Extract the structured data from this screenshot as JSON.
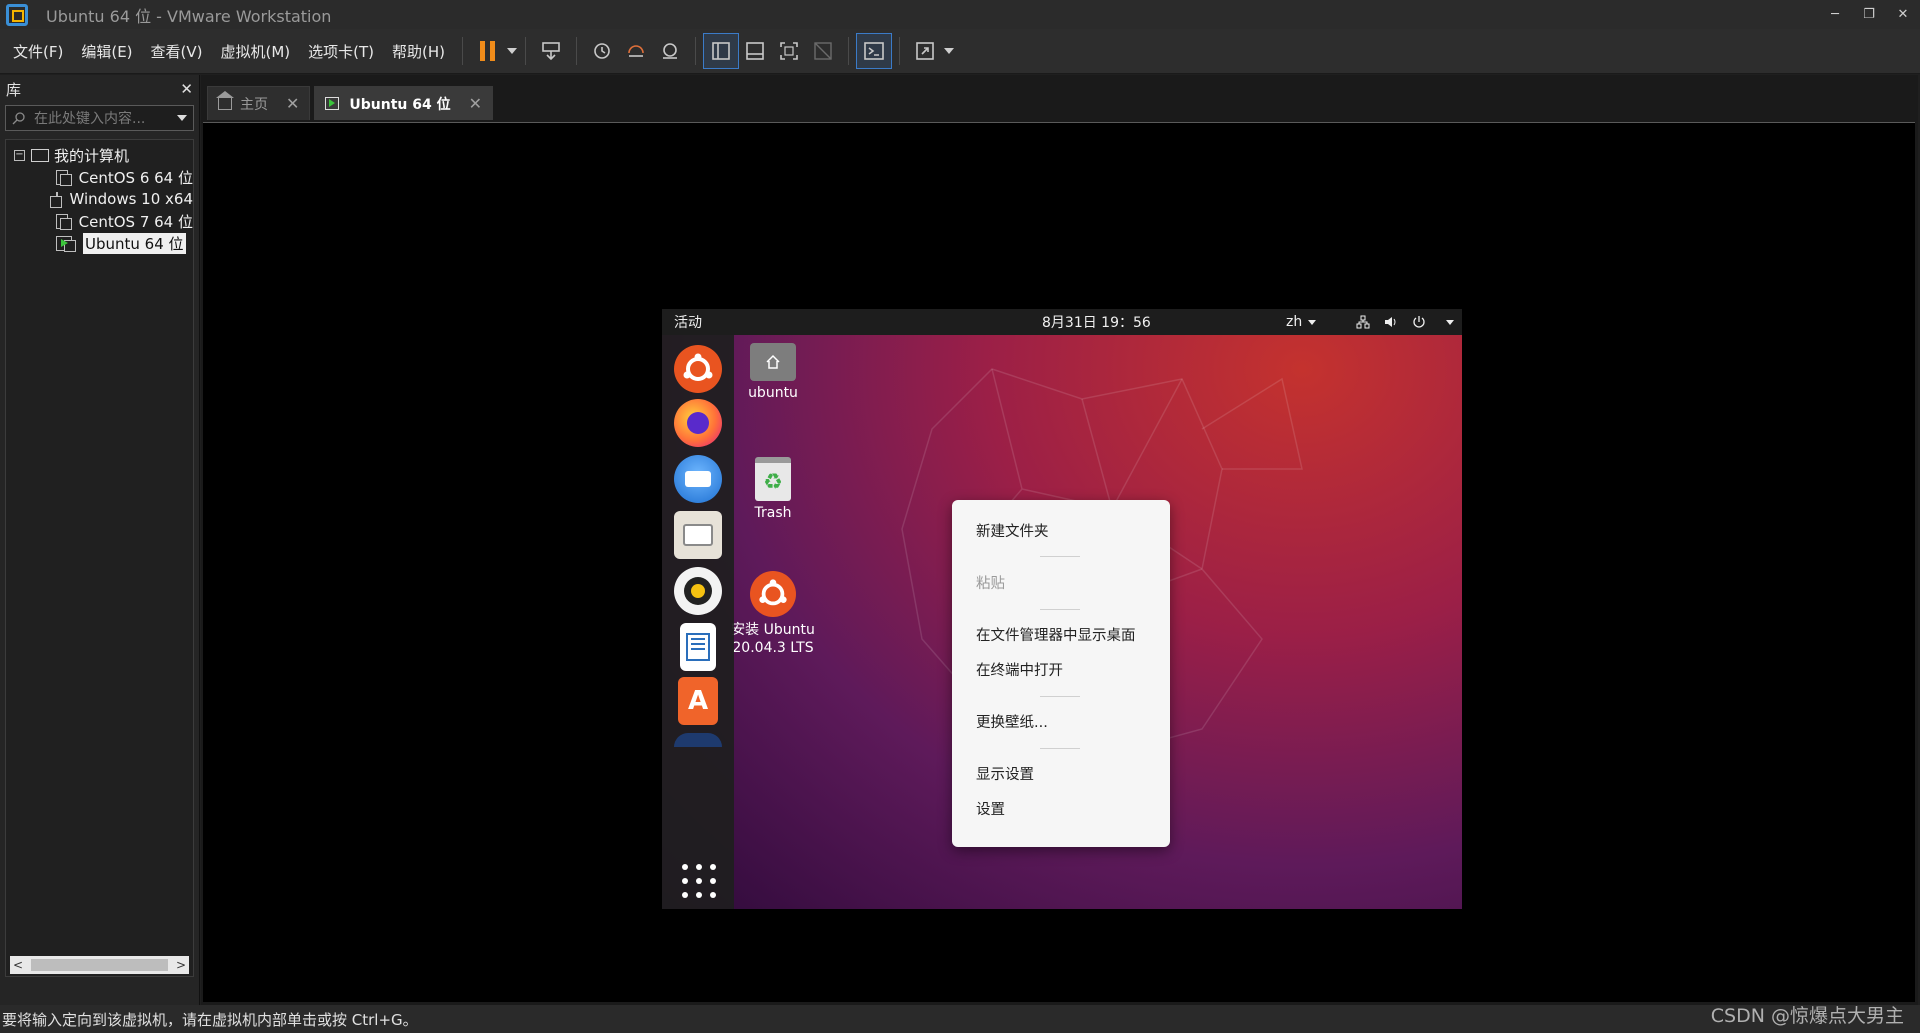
{
  "window": {
    "title": "Ubuntu 64 位 - VMware Workstation",
    "controls": {
      "minimize": "─",
      "restore": "❐",
      "close": "✕"
    }
  },
  "menu": [
    "文件(F)",
    "编辑(E)",
    "查看(V)",
    "虚拟机(M)",
    "选项卡(T)",
    "帮助(H)"
  ],
  "toolbar": {
    "icons": [
      "pause-icon",
      "send-keys-icon",
      "snapshot-icon",
      "revert-snapshot-icon",
      "snapshot-manager-icon",
      "library-view-icon",
      "thumbnail-view-icon",
      "fullscreen-icon",
      "unity-icon",
      "console-icon",
      "stretch-icon"
    ],
    "accent": "#f08c1a"
  },
  "library": {
    "title": "库",
    "close": "✕",
    "search_placeholder": "在此处键入内容...",
    "tree": {
      "root": "我的计算机",
      "toggle": "−",
      "vms": [
        {
          "label": "CentOS 6 64 位",
          "running": false,
          "selected": false
        },
        {
          "label": "Windows 10 x64",
          "running": false,
          "selected": false
        },
        {
          "label": "CentOS 7 64 位",
          "running": false,
          "selected": false
        },
        {
          "label": "Ubuntu 64 位",
          "running": true,
          "selected": true
        }
      ]
    },
    "scroll": {
      "left": "<",
      "right": ">"
    }
  },
  "tabs": [
    {
      "label": "主页",
      "close": "✕",
      "active": false
    },
    {
      "label": "Ubuntu 64 位",
      "close": "✕",
      "active": true
    }
  ],
  "guest": {
    "topbar": {
      "activities": "活动",
      "clock": "8月31日  19：56",
      "lang": "zh",
      "tray_icons": [
        "network-icon",
        "volume-icon",
        "power-icon"
      ]
    },
    "dock": [
      "ubuntu-installer-icon",
      "firefox-icon",
      "thunderbird-icon",
      "files-icon",
      "rhythmbox-icon",
      "libreoffice-writer-icon",
      "software-center-icon",
      "help-icon",
      "show-apps-icon"
    ],
    "desktop_icons": [
      {
        "label": "ubuntu",
        "icon": "home-folder-icon"
      },
      {
        "label": "Trash",
        "icon": "trash-icon"
      },
      {
        "label": "安装 Ubuntu\n20.04.3 LTS",
        "icon": "install-ubuntu-icon"
      }
    ],
    "context_menu": {
      "new_folder": "新建文件夹",
      "paste": "粘贴",
      "show_in_files": "在文件管理器中显示桌面",
      "open_terminal": "在终端中打开",
      "change_bg": "更换壁纸...",
      "display_settings": "显示设置",
      "settings": "设置"
    }
  },
  "status": "要将输入定向到该虚拟机，请在虚拟机内部单击或按 Ctrl+G。",
  "watermark": "CSDN @惊爆点大男主"
}
